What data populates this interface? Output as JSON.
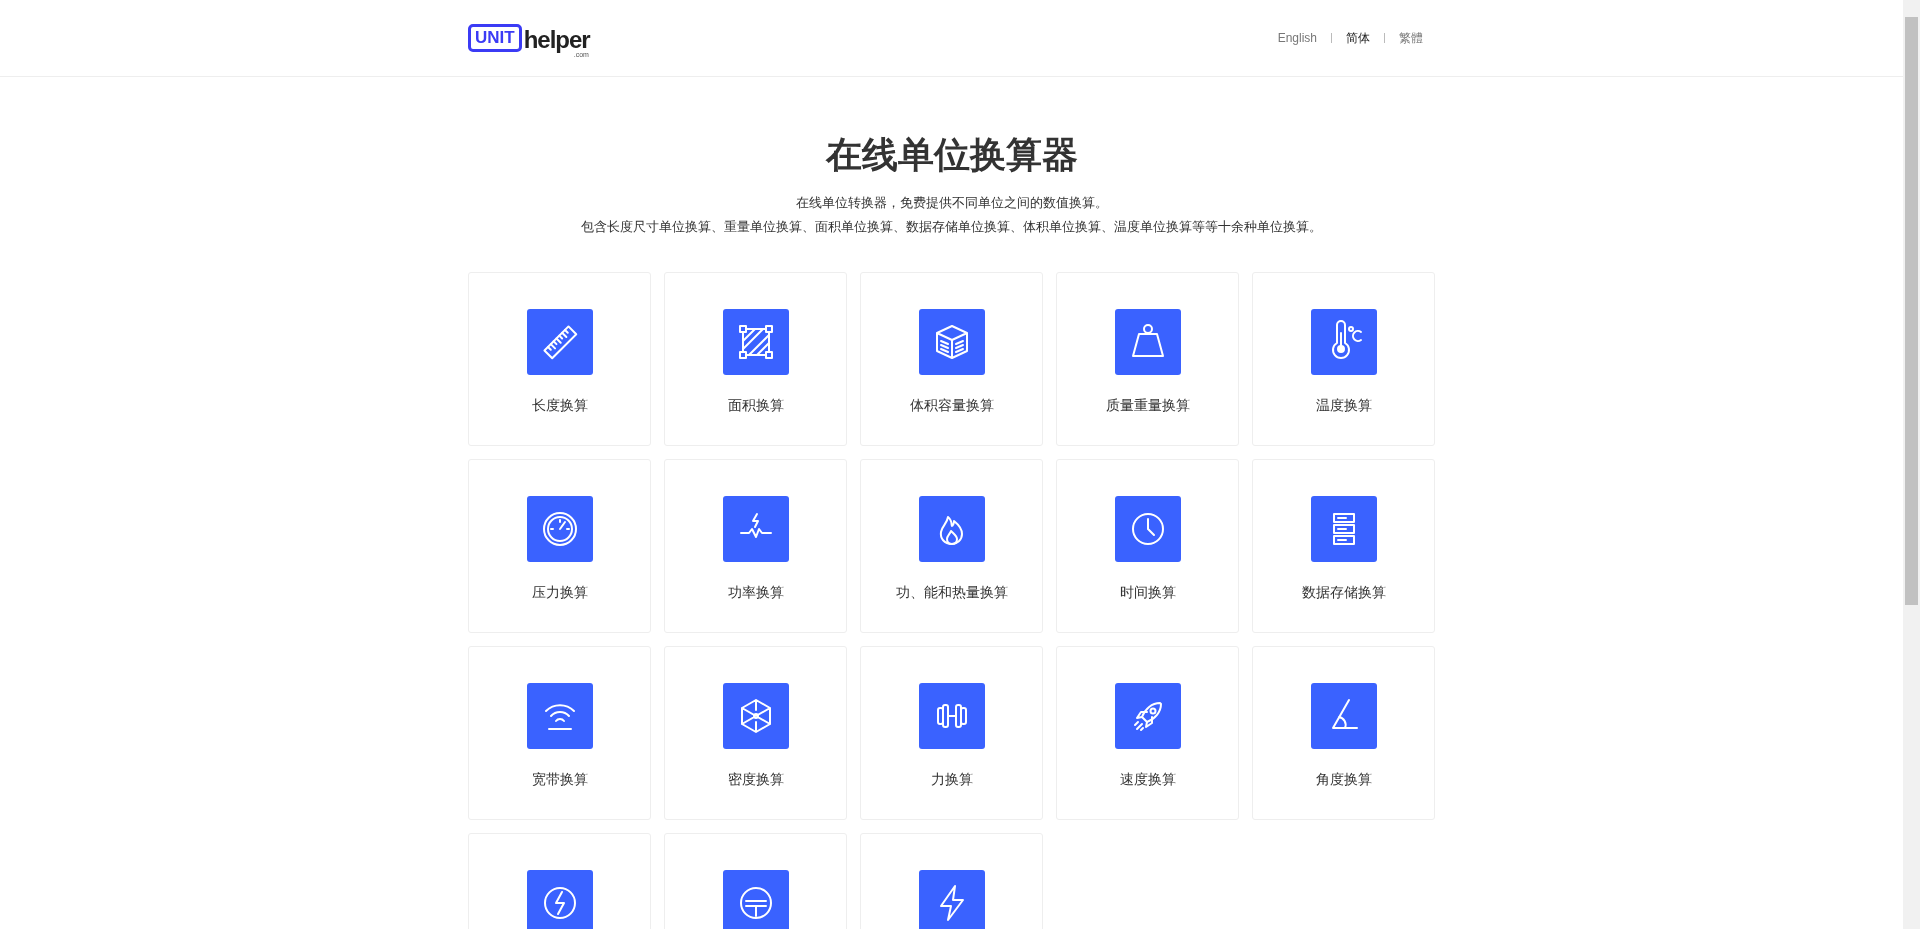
{
  "header": {
    "logo": {
      "badge": "UNIT",
      "name": "helper",
      "suffix": ".com"
    },
    "languages": [
      {
        "label": "English",
        "selected": false
      },
      {
        "label": "简体",
        "selected": true
      },
      {
        "label": "繁體",
        "selected": false
      }
    ]
  },
  "hero": {
    "title": "在线单位换算器",
    "lines": [
      "在线单位转换器，免费提供不同单位之间的数值换算。",
      "包含长度尺寸单位换算、重量单位换算、面积单位换算、数据存储单位换算、体积单位换算、温度单位换算等等十余种单位换算。"
    ]
  },
  "cards": [
    {
      "kind": "tile",
      "label": "长度换算"
    },
    {
      "kind": "tile",
      "label": "面积换算"
    },
    {
      "kind": "tile",
      "label": "体积容量换算"
    },
    {
      "kind": "tile",
      "label": "质量重量换算"
    },
    {
      "kind": "tile",
      "label": "温度换算"
    },
    {
      "kind": "tile",
      "label": "压力换算"
    },
    {
      "kind": "tile",
      "label": "功率换算"
    },
    {
      "kind": "tile",
      "label": "功、能和热量换算"
    },
    {
      "kind": "tile",
      "label": "时间换算"
    },
    {
      "kind": "tile",
      "label": "数据存储换算"
    },
    {
      "kind": "tile",
      "label": "宽带换算"
    },
    {
      "kind": "tile",
      "label": "密度换算"
    },
    {
      "kind": "tile",
      "label": "力换算"
    },
    {
      "kind": "tile",
      "label": "速度换算"
    },
    {
      "kind": "tile",
      "label": "角度换算"
    },
    {
      "kind": "tile"
    },
    {
      "kind": "tile"
    },
    {
      "kind": "tile"
    }
  ]
}
